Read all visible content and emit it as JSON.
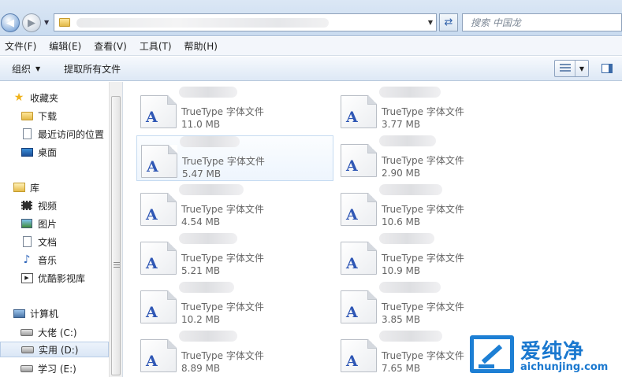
{
  "search": {
    "placeholder": "搜索 中国龙"
  },
  "menu": [
    "文件(F)",
    "编辑(E)",
    "查看(V)",
    "工具(T)",
    "帮助(H)"
  ],
  "toolbar": {
    "organize": "组织",
    "extract": "提取所有文件"
  },
  "nav": [
    {
      "label": "收藏夹",
      "icon": "star-icon"
    },
    {
      "label": "下载",
      "icon": "download-folder-icon"
    },
    {
      "label": "最近访问的位置",
      "icon": "recent-places-icon"
    },
    {
      "label": "桌面",
      "icon": "desktop-icon"
    },
    {
      "label": "库",
      "icon": "library-icon"
    },
    {
      "label": "视频",
      "icon": "video-icon"
    },
    {
      "label": "图片",
      "icon": "picture-icon"
    },
    {
      "label": "文档",
      "icon": "document-icon"
    },
    {
      "label": "音乐",
      "icon": "music-icon"
    },
    {
      "label": "优酷影视库",
      "icon": "youku-icon"
    },
    {
      "label": "计算机",
      "icon": "computer-icon"
    },
    {
      "label": "大佬 (C:)",
      "icon": "drive-icon"
    },
    {
      "label": "实用 (D:)",
      "icon": "drive-icon",
      "selected": true
    },
    {
      "label": "学习 (E:)",
      "icon": "drive-icon"
    }
  ],
  "files": [
    {
      "type": "TrueType 字体文件",
      "size": "11.0 MB"
    },
    {
      "type": "TrueType 字体文件",
      "size": "3.77 MB"
    },
    {
      "type": "TrueType 字体文件",
      "size": "5.47 MB",
      "selected": true
    },
    {
      "type": "TrueType 字体文件",
      "size": "2.90 MB"
    },
    {
      "type": "TrueType 字体文件",
      "size": "4.54 MB"
    },
    {
      "type": "TrueType 字体文件",
      "size": "10.6 MB"
    },
    {
      "type": "TrueType 字体文件",
      "size": "5.21 MB"
    },
    {
      "type": "TrueType 字体文件",
      "size": "10.9 MB"
    },
    {
      "type": "TrueType 字体文件",
      "size": "10.2 MB"
    },
    {
      "type": "TrueType 字体文件",
      "size": "3.85 MB"
    },
    {
      "type": "TrueType 字体文件",
      "size": "8.89 MB"
    },
    {
      "type": "TrueType 字体文件",
      "size": "7.65 MB"
    }
  ],
  "file_icon_glyph": "A",
  "watermark": {
    "brand": "爱纯净",
    "url": "aichunjing.com"
  }
}
